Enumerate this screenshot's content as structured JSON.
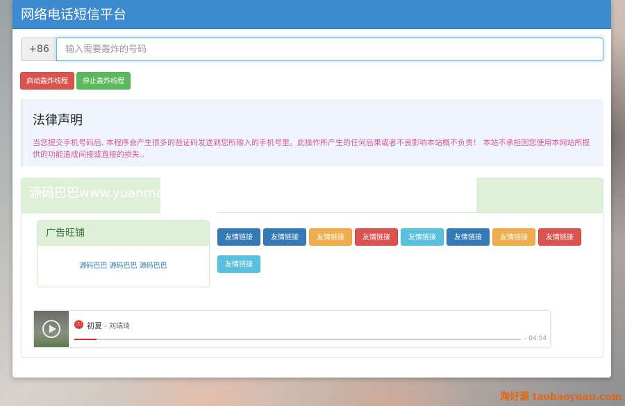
{
  "header": {
    "title": "网络电话短信平台"
  },
  "phone": {
    "prefix": "+86",
    "placeholder": "输入需要轰炸的号码"
  },
  "actions": {
    "start": "启动轰炸线程",
    "stop": "停止轰炸线程"
  },
  "legal": {
    "title": "法律声明",
    "text": "当您提交手机号码后, 本程序会产生很多的验证码发送到您所输入的手机号里。此操作所产生的任何后果或者不良影响本站概不负责！ 本站不承担因您使用本网站所提供的功能造成间接或直接的损失.."
  },
  "box": {
    "title": "源码巴巴www.yuanma"
  },
  "ad": {
    "title": "广告旺铺",
    "text": "源码巴巴 源码巴巴 源码巴巴"
  },
  "links": [
    {
      "label": "友情链接",
      "color": "blue"
    },
    {
      "label": "友情链接",
      "color": "blue"
    },
    {
      "label": "友情链接",
      "color": "orange"
    },
    {
      "label": "友情链接",
      "color": "red"
    },
    {
      "label": "友情链接",
      "color": "cyan"
    },
    {
      "label": "友情链接",
      "color": "blue"
    },
    {
      "label": "友情链接",
      "color": "orange"
    },
    {
      "label": "友情链接",
      "color": "red"
    },
    {
      "label": "友情链接",
      "color": "cyan"
    }
  ],
  "player": {
    "song": "初夏",
    "artist": " - 刘瑞琦",
    "time": "- 04:54",
    "progress": 0.05,
    "icon_glyph": "ⓒ"
  },
  "watermark": "淘好源 taohaoyuan.com"
}
